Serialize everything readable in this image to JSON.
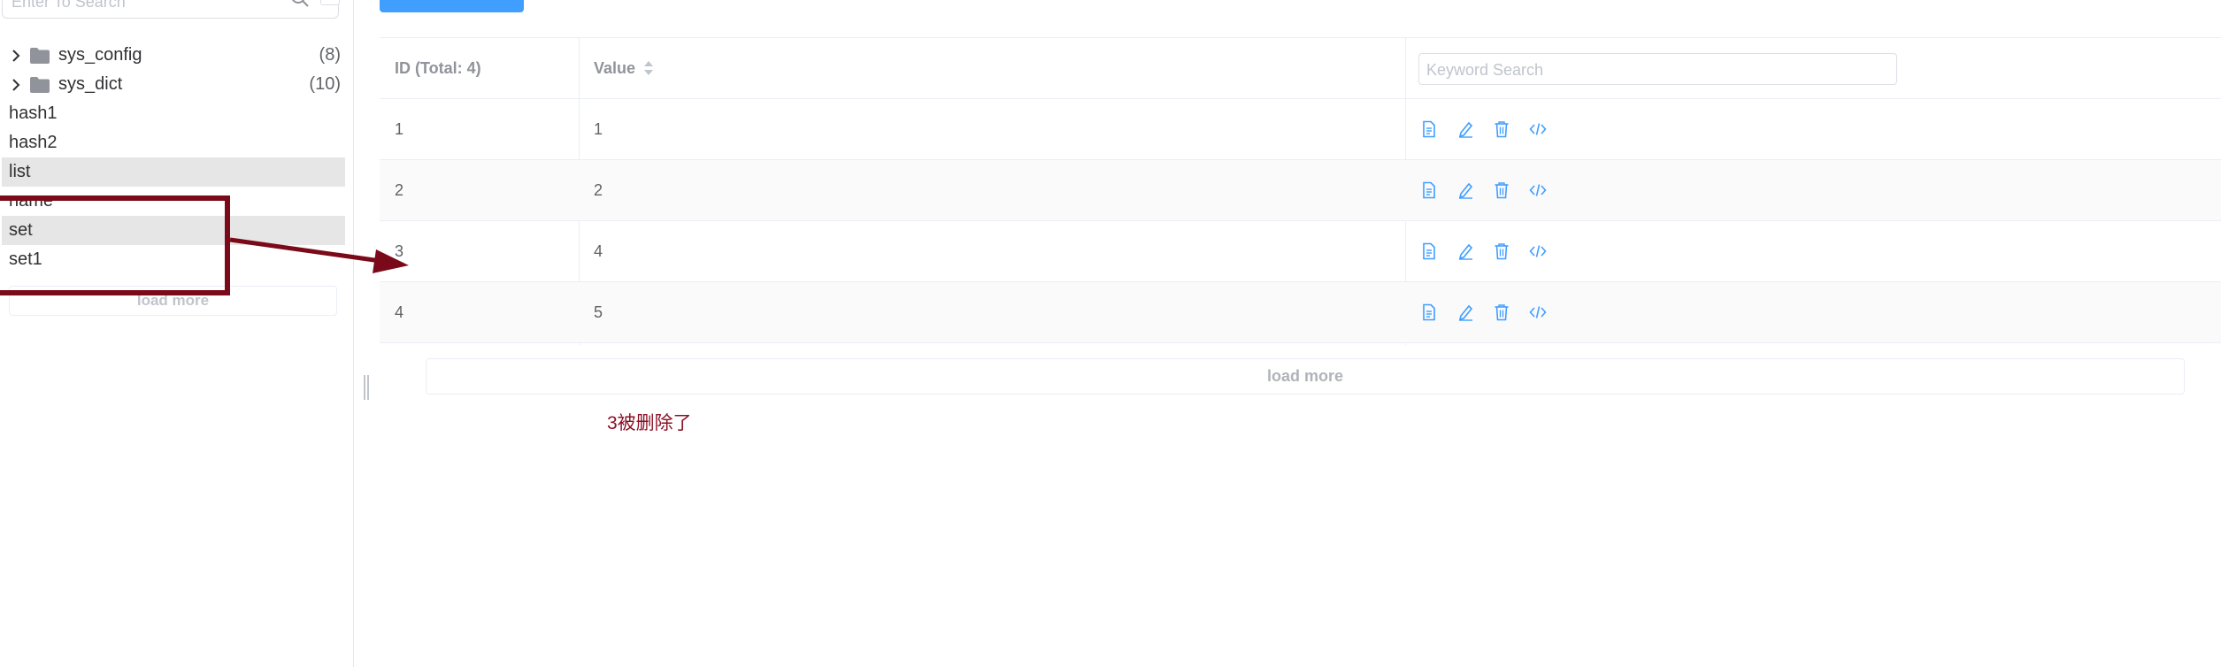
{
  "sidebar": {
    "search": {
      "placeholder": "Enter To Search"
    },
    "folders": [
      {
        "name": "sys_config",
        "count": "(8)"
      },
      {
        "name": "sys_dict",
        "count": "(10)"
      }
    ],
    "keys": [
      {
        "name": "hash1",
        "selected": false
      },
      {
        "name": "hash2",
        "selected": false
      },
      {
        "name": "list",
        "selected": true
      },
      {
        "name": "name",
        "selected": false
      },
      {
        "name": "set",
        "selected": true
      },
      {
        "name": "set1",
        "selected": false
      }
    ],
    "load_more": "load more"
  },
  "table": {
    "headers": {
      "id": "ID (Total: 4)",
      "value": "Value"
    },
    "keyword_search": {
      "placeholder": "Keyword Search"
    },
    "rows": [
      {
        "id": "1",
        "value": "1"
      },
      {
        "id": "2",
        "value": "2"
      },
      {
        "id": "3",
        "value": "4"
      },
      {
        "id": "4",
        "value": "5"
      }
    ],
    "actions": [
      "document-icon",
      "edit-icon",
      "delete-icon",
      "code-icon"
    ],
    "load_more": "load more"
  },
  "annotation": {
    "text": "3被删除了"
  },
  "colors": {
    "accent": "#409eff",
    "action_icon": "#409eff",
    "annotation": "#7a0a1a",
    "selected_row": "#e6e6e6"
  }
}
